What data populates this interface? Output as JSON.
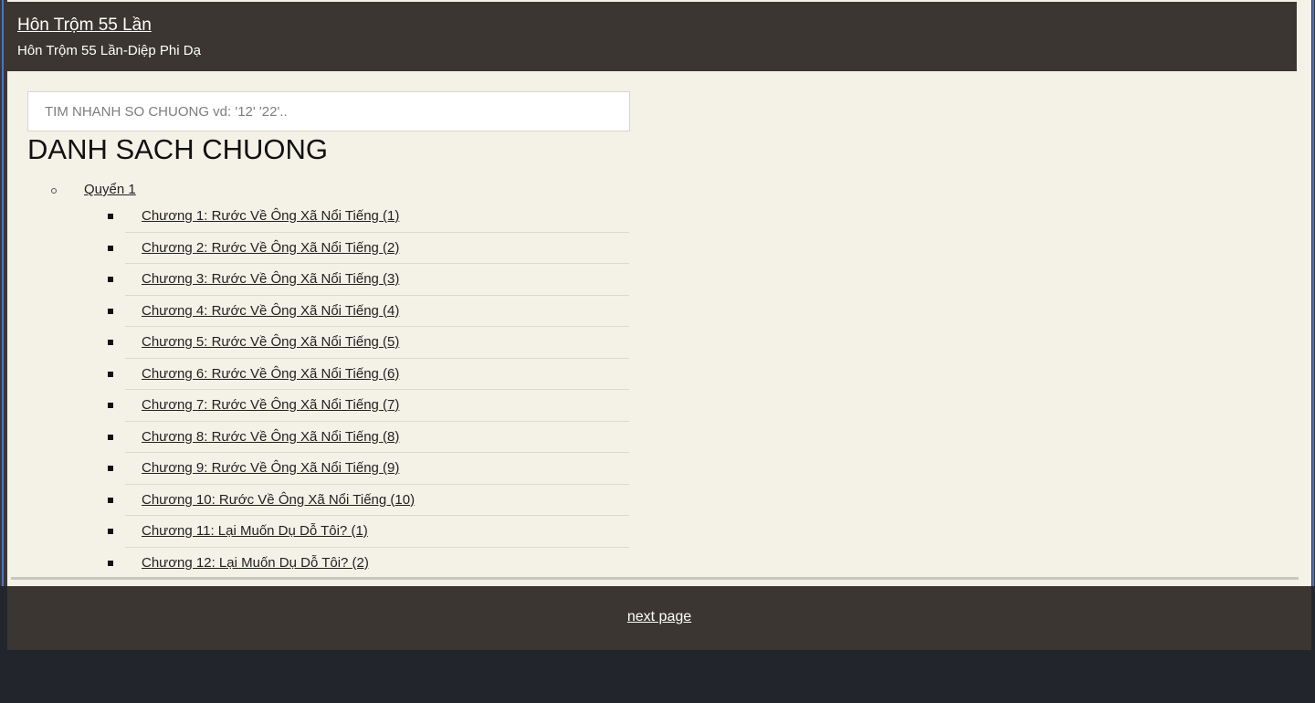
{
  "header": {
    "title": "Hôn Trộm 55 Lần",
    "subtitle": "Hôn Trộm 55 Lần-Diệp Phi Dạ"
  },
  "search": {
    "placeholder": "TIM NHANH SO CHUONG vd: '12' '22'.."
  },
  "chapter_list": {
    "heading": "DANH SACH CHUONG",
    "volume_label": "Quyển 1",
    "chapters": [
      "Chương 1: Rước Về Ông Xã Nổi Tiếng (1)",
      "Chương 2: Rước Về Ông Xã Nổi Tiếng (2)",
      "Chương 3: Rước Về Ông Xã Nổi Tiếng (3)",
      "Chương 4: Rước Về Ông Xã Nổi Tiếng (4)",
      "Chương 5: Rước Về Ông Xã Nổi Tiếng (5)",
      "Chương 6: Rước Về Ông Xã Nổi Tiếng (6)",
      "Chương 7: Rước Về Ông Xã Nổi Tiếng (7)",
      "Chương 8: Rước Về Ông Xã Nổi Tiếng (8)",
      "Chương 9: Rước Về Ông Xã Nổi Tiếng (9)",
      "Chương 10: Rước Về Ông Xã Nổi Tiếng (10)",
      "Chương 11: Lại Muốn Dụ Dỗ Tôi? (1)",
      "Chương 12: Lại Muốn Dụ Dỗ Tôi? (2)"
    ]
  },
  "footer": {
    "next_label": "next page"
  },
  "colors": {
    "header_bg": "#3b3631",
    "page_bg": "#f4f1e7",
    "bottom_bg": "#22252c",
    "window_border": "#4a73c9"
  }
}
